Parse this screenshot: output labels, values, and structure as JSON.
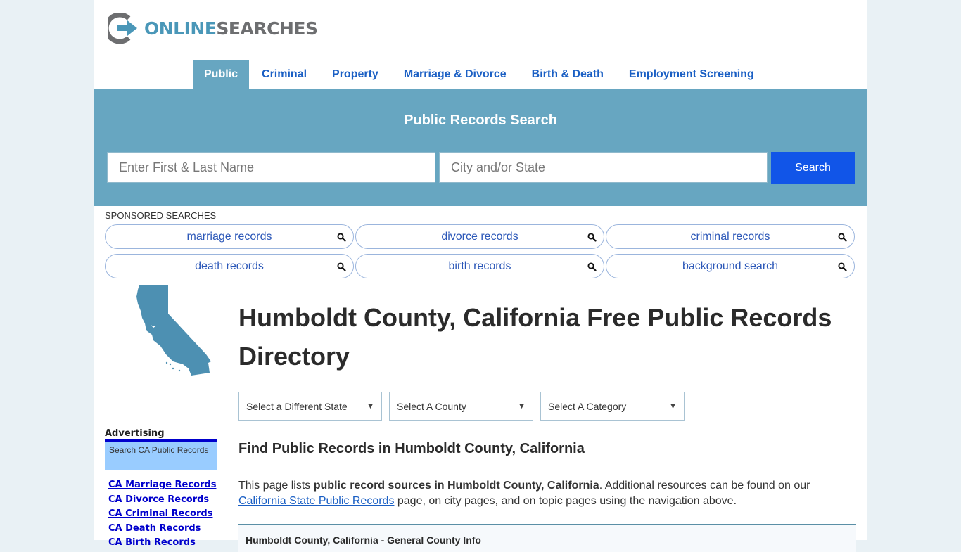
{
  "brand": {
    "logo_part1": "ONLINE",
    "logo_part2": "SEARCHES",
    "colors": {
      "blue": "#4a97b8",
      "gray": "#6d6e70"
    }
  },
  "nav": {
    "items": [
      {
        "label": "Public",
        "active": true
      },
      {
        "label": "Criminal"
      },
      {
        "label": "Property"
      },
      {
        "label": "Marriage & Divorce"
      },
      {
        "label": "Birth & Death"
      },
      {
        "label": "Employment Screening"
      }
    ]
  },
  "search": {
    "title": "Public Records Search",
    "name_placeholder": "Enter First & Last Name",
    "location_placeholder": "City and/or State",
    "button_label": "Search",
    "colors": {
      "banner": "#67a6c1",
      "button": "#1155e8"
    }
  },
  "sponsored": {
    "label": "SPONSORED SEARCHES",
    "items": [
      {
        "label": "marriage records",
        "icon": "search-icon"
      },
      {
        "label": "divorce records",
        "icon": "search-icon"
      },
      {
        "label": "criminal records",
        "icon": "search-icon"
      },
      {
        "label": "death records",
        "icon": "search-icon"
      },
      {
        "label": "birth records",
        "icon": "search-icon"
      },
      {
        "label": "background search",
        "icon": "search-icon"
      }
    ]
  },
  "sidebar": {
    "map_icon": "california-map",
    "advertising_label": "Advertising",
    "ad_box_text": "Search CA Public Records",
    "links": [
      "CA Marriage Records",
      "CA Divorce Records",
      "CA Criminal Records",
      "CA Death Records",
      "CA Birth Records"
    ]
  },
  "main": {
    "title": "Humboldt County, California Free Public Records Directory",
    "selects": [
      {
        "value": "Select a Different State"
      },
      {
        "value": "Select A County"
      },
      {
        "value": "Select A Category"
      }
    ],
    "subtitle": "Find Public Records in Humboldt County, California",
    "intro": {
      "text1": "This page lists ",
      "bold": "public record sources in Humboldt County, California",
      "text2": ". Additional resources can be found on our ",
      "link": "California State Public Records",
      "text3": " page, on city pages, and on topic pages using the navigation above."
    },
    "info_box_title": "Humboldt County, California - General County Info"
  }
}
